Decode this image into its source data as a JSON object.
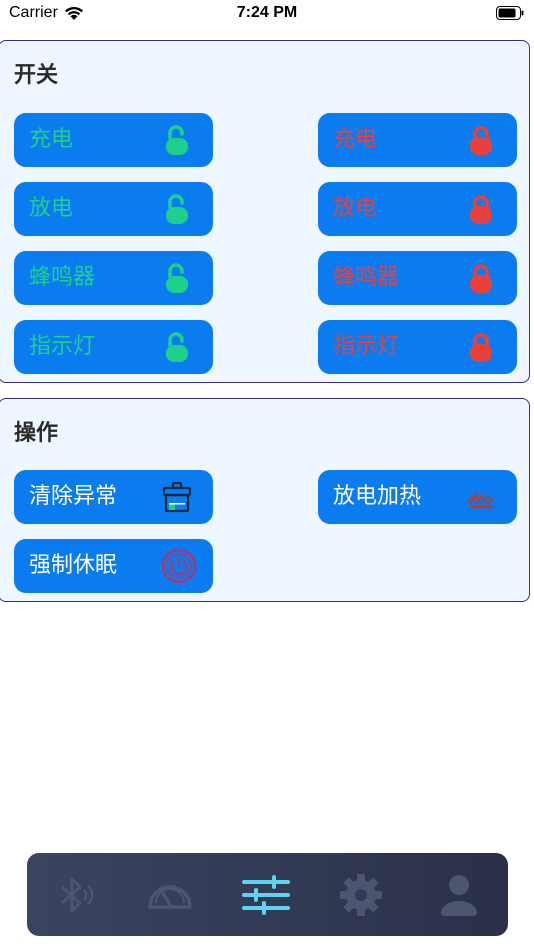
{
  "status_bar": {
    "carrier": "Carrier",
    "time": "7:24 PM"
  },
  "switch_panel": {
    "title": "开关",
    "rows": [
      {
        "on_label": "充电",
        "off_label": "充电"
      },
      {
        "on_label": "放电",
        "off_label": "放电"
      },
      {
        "on_label": "蜂鸣器",
        "off_label": "蜂鸣器"
      },
      {
        "on_label": "指示灯",
        "off_label": "指示灯"
      }
    ]
  },
  "ops_panel": {
    "title": "操作",
    "buttons": [
      {
        "label": "清除异常",
        "icon": "clear-box-icon"
      },
      {
        "label": "放电加热",
        "icon": "heat-icon"
      },
      {
        "label": "强制休眠",
        "icon": "power-icon"
      }
    ]
  },
  "tab_bar": {
    "tabs": [
      {
        "icon": "bluetooth-icon",
        "active": false
      },
      {
        "icon": "gauge-icon",
        "active": false
      },
      {
        "icon": "sliders-icon",
        "active": true
      },
      {
        "icon": "gear-icon",
        "active": false
      },
      {
        "icon": "user-icon",
        "active": false
      }
    ]
  },
  "colors": {
    "button_bg": "#0a7cf0",
    "on_color": "#1fcf8c",
    "off_color": "#e8403c",
    "panel_border": "#3d2a8c",
    "active_tab": "#5fd2f0"
  }
}
